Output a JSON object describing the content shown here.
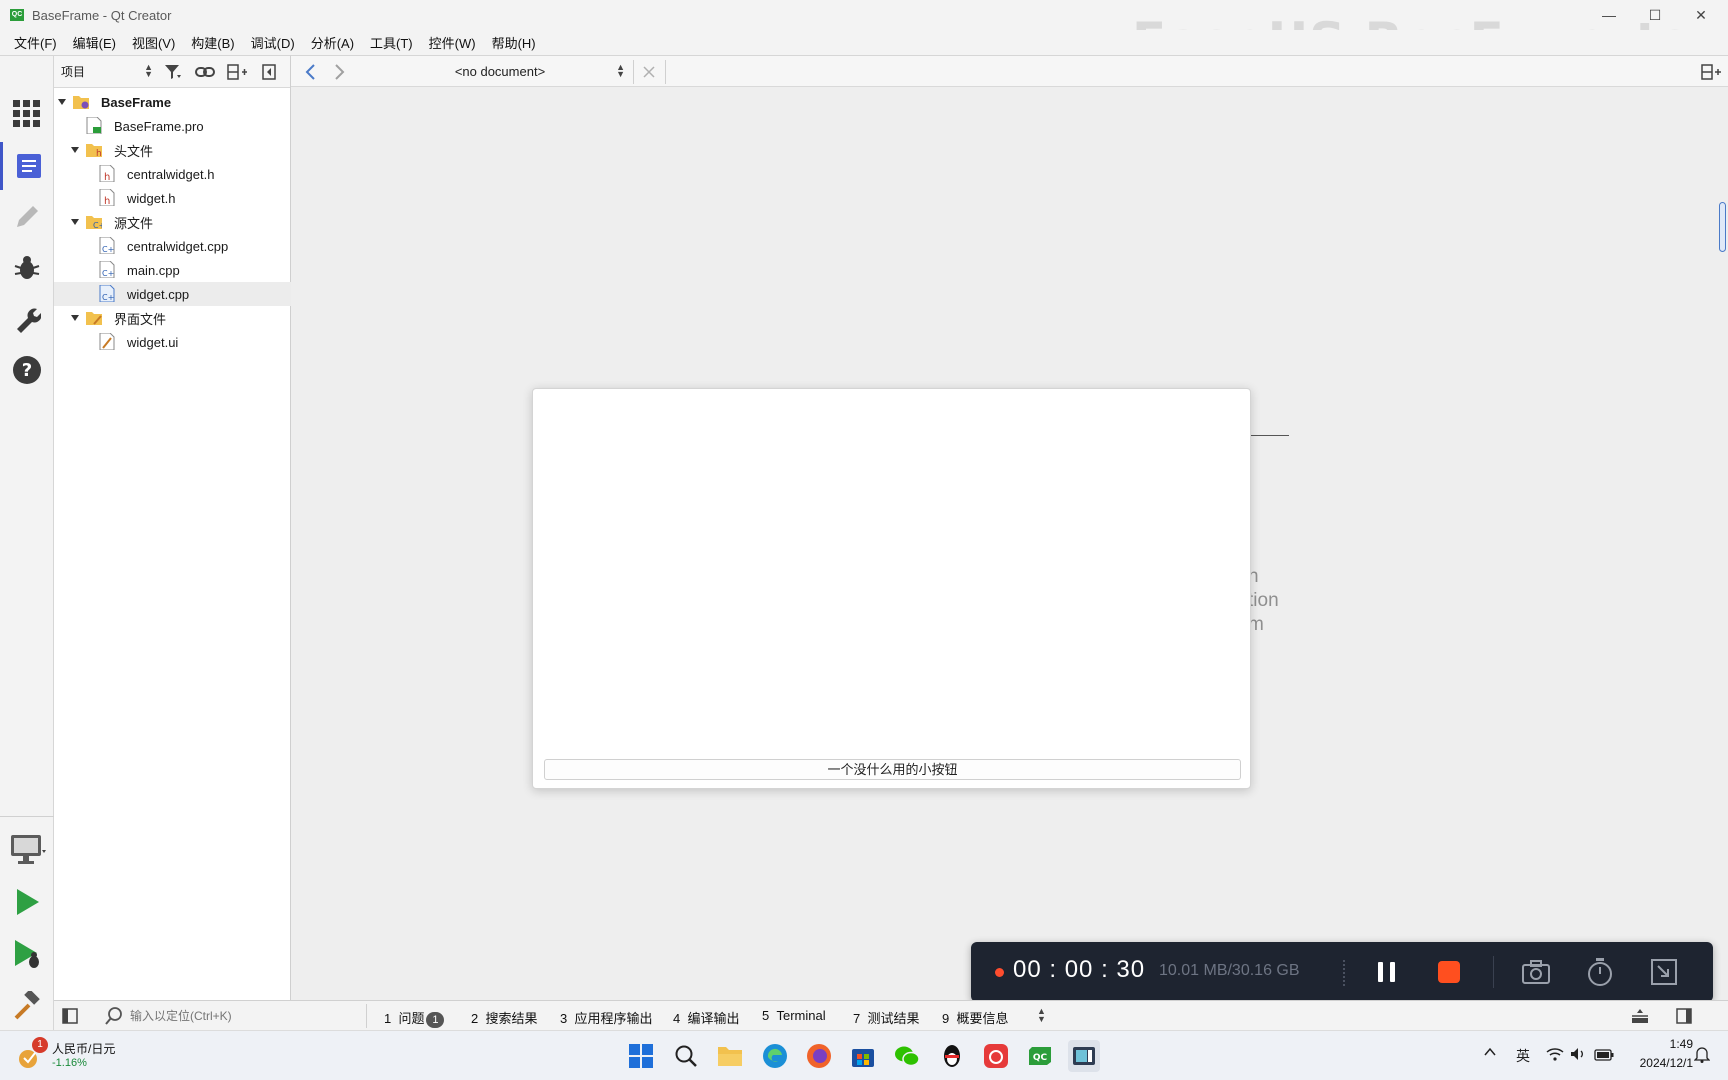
{
  "window": {
    "title": "BaseFrame - Qt Creator",
    "controls": {
      "minimize": "—",
      "maximize": "☐",
      "close": "✕"
    }
  },
  "watermark": "EaseUS RecExperts",
  "menubar": {
    "items": [
      "文件(F)",
      "编辑(E)",
      "视图(V)",
      "构建(B)",
      "调试(D)",
      "分析(A)",
      "工具(T)",
      "控件(W)",
      "帮助(H)"
    ]
  },
  "modebar": {
    "modes": [
      "welcome",
      "edit",
      "design",
      "debug",
      "projects",
      "help"
    ],
    "active": "edit",
    "bottom": [
      "kit-selector",
      "run",
      "start-debugging",
      "build"
    ]
  },
  "project_panel": {
    "view_selector": "项目",
    "tree": [
      {
        "label": "BaseFrame",
        "level": 0,
        "expanded": true,
        "kind": "project",
        "bold": true
      },
      {
        "label": "BaseFrame.pro",
        "level": 1,
        "kind": "pro"
      },
      {
        "label": "头文件",
        "level": 1,
        "expanded": true,
        "kind": "folder-h"
      },
      {
        "label": "centralwidget.h",
        "level": 2,
        "kind": "header"
      },
      {
        "label": "widget.h",
        "level": 2,
        "kind": "header"
      },
      {
        "label": "源文件",
        "level": 1,
        "expanded": true,
        "kind": "folder-cpp"
      },
      {
        "label": "centralwidget.cpp",
        "level": 2,
        "kind": "cpp"
      },
      {
        "label": "main.cpp",
        "level": 2,
        "kind": "cpp"
      },
      {
        "label": "widget.cpp",
        "level": 2,
        "kind": "cpp",
        "selected": true
      },
      {
        "label": "界面文件",
        "level": 1,
        "expanded": true,
        "kind": "folder-ui"
      },
      {
        "label": "widget.ui",
        "level": 2,
        "kind": "ui"
      }
    ]
  },
  "editor": {
    "document_selector": "<no document>",
    "background_fragments": [
      "n",
      "tion",
      "m"
    ]
  },
  "app_window": {
    "button_label": "一个没什么用的小按钮"
  },
  "recorder": {
    "time": "00 : 00 : 30",
    "size": "10.01 MB/30.16 GB",
    "accent": "#ff4f1f"
  },
  "statusbar": {
    "locator_placeholder": "输入以定位(Ctrl+K)",
    "tabs": [
      {
        "num": "1",
        "label": "问题",
        "badge": "1"
      },
      {
        "num": "2",
        "label": "搜索结果"
      },
      {
        "num": "3",
        "label": "应用程序输出"
      },
      {
        "num": "4",
        "label": "编译输出"
      },
      {
        "num": "5",
        "label": "Terminal"
      },
      {
        "num": "7",
        "label": "测试结果"
      },
      {
        "num": "9",
        "label": "概要信息"
      }
    ]
  },
  "taskbar": {
    "widget": {
      "title": "人民币/日元",
      "change": "-1.16%",
      "badge": "1"
    },
    "apps": [
      "start",
      "search",
      "file-explorer",
      "edge",
      "firefox",
      "store",
      "wechat",
      "qq",
      "netease-music",
      "qt-creator",
      "recexperts"
    ],
    "tray": {
      "language": "英",
      "time": "1:49",
      "date": "2024/12/1"
    }
  }
}
